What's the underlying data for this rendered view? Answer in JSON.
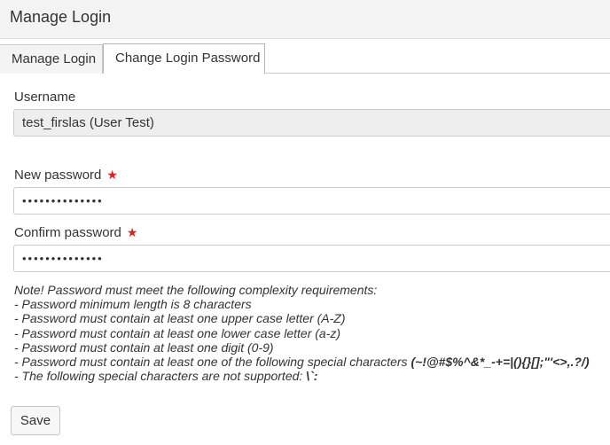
{
  "header": {
    "title": "Manage Login"
  },
  "tabs": [
    {
      "label": "Manage Login",
      "active": false
    },
    {
      "label": "Change Login Password",
      "active": true
    }
  ],
  "form": {
    "username_label": "Username",
    "username_value": "test_firslas (User Test)",
    "new_password_label": "New password",
    "new_password_value": "••••••••••••••",
    "confirm_password_label": "Confirm password",
    "confirm_password_value": "••••••••••••••",
    "required_marker": "★"
  },
  "notes": {
    "intro": "Note! Password must meet the following complexity requirements:",
    "rules": [
      "- Password minimum length is 8 characters",
      "- Password must contain at least one upper case letter (A-Z)",
      "- Password must contain at least one lower case letter (a-z)",
      "- Password must contain at least one digit (0-9)"
    ],
    "special_prefix": "- Password must contain at least one of the following special characters ",
    "special_chars": "(~!@#$%^&*_-+=|(){}[];\"'<>,.?/)",
    "unsupported_prefix": "- The following special characters are not supported: ",
    "unsupported_chars": "\\`:"
  },
  "actions": {
    "save_label": "Save"
  },
  "colors": {
    "required": "#e02020",
    "header_bg": "#f3f3f3",
    "readonly_bg": "#eeeeee"
  }
}
